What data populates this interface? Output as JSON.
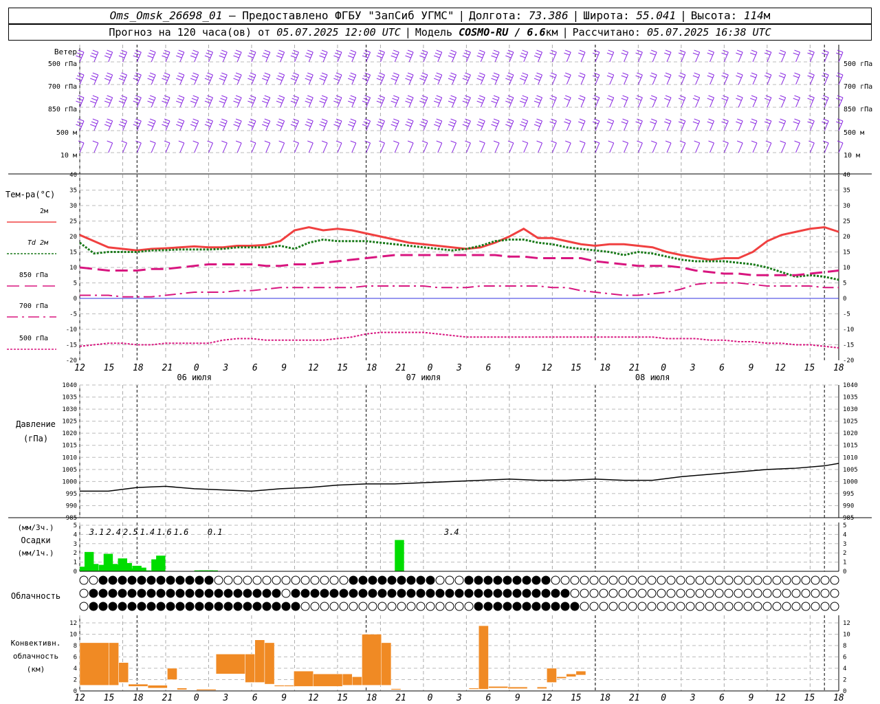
{
  "header": {
    "station": "Oms_Omsk_26698_01",
    "dash": "–",
    "provider": "Предоставлено ФГБУ \"ЗапСиб УГМС\"",
    "lon_label": "Долгота:",
    "lon_value": "73.386",
    "lat_label": "Широта:",
    "lat_value": "55.041",
    "alt_label": "Высота:",
    "alt_value": "114",
    "alt_unit": "м",
    "forecast_label": "Прогноз на 120 часа(ов) от",
    "forecast_start": "05.07.2025 12:00 UTC",
    "model_label": "Модель",
    "model_name": "COSMO-RU / 6.6",
    "model_unit": "км",
    "calc_label": "Рассчитано:",
    "calc_time": "05.07.2025 16:38 UTC"
  },
  "colors": {
    "wind": "#8b2be2",
    "t2m": "#f04040",
    "td": "#1a7a1a",
    "t850": "#d8157f",
    "zero": "#3030e0",
    "precip": "#00dd00",
    "conv": "#f08a24",
    "grid": "#bbbbbb"
  },
  "time_axis": {
    "hours": [
      "12",
      "15",
      "18",
      "21",
      "0",
      "3",
      "6",
      "9",
      "12",
      "15",
      "18",
      "21",
      "0",
      "3",
      "6",
      "9",
      "12",
      "15",
      "18",
      "21",
      "0",
      "3",
      "6",
      "9",
      "12",
      "15",
      "18"
    ],
    "dates": [
      "06 июля",
      "07 июля",
      "08 июля"
    ]
  },
  "panels": {
    "wind": {
      "title": "Ветер",
      "levels": [
        "500 гПа",
        "700 гПа",
        "850 гПа",
        "500 м",
        "10  м"
      ],
      "right_levels": [
        "500 гПа",
        "700 гПа",
        "850 гПа",
        "500 м",
        "10  м"
      ]
    },
    "temp": {
      "title": "Тем-ра(°С)",
      "legend": [
        "2м",
        "Td  2м",
        "850 гПа",
        "700 гПа",
        "500 гПа"
      ],
      "ticks": [
        "40",
        "35",
        "30",
        "25",
        "20",
        "15",
        "10",
        "5",
        "0",
        "-5",
        "-10",
        "-15",
        "-20"
      ]
    },
    "pressure": {
      "title": "Давление",
      "unit": "(гПа)",
      "ticks": [
        "1040",
        "1035",
        "1030",
        "1025",
        "1020",
        "1015",
        "1010",
        "1005",
        "1000",
        "995",
        "990",
        "985"
      ]
    },
    "precip": {
      "unit_top": "(мм/3ч.)",
      "title": "Осадки",
      "unit_bottom": "(мм/1ч.)",
      "ticks": [
        "5",
        "4",
        "3",
        "2",
        "1",
        "0"
      ],
      "totals": [
        {
          "x": 3,
          "text": "3.1"
        },
        {
          "x": 6,
          "text": "2.4"
        },
        {
          "x": 9,
          "text": "2.5"
        },
        {
          "x": 12,
          "text": "1.4"
        },
        {
          "x": 15,
          "text": "1.6"
        },
        {
          "x": 18,
          "text": "1.6"
        },
        {
          "x": 24,
          "text": "0.1"
        },
        {
          "x": 66,
          "text": "3.4"
        }
      ]
    },
    "cloud": {
      "title": "Облачность"
    },
    "conv": {
      "title_1": "Конвективн.",
      "title_2": "облачность",
      "unit": "(км)",
      "ticks": [
        "12",
        "10",
        "8",
        "6",
        "4",
        "2",
        "0"
      ]
    }
  },
  "chart_data": [
    {
      "type": "line",
      "title": "Тем-ра(°С)",
      "x_unit": "hours since 05.07.2025 12:00 UTC",
      "x": [
        0,
        3,
        6,
        9,
        12,
        15,
        18,
        21,
        24,
        27,
        30,
        33,
        36,
        39,
        42,
        45,
        48,
        51,
        54,
        57,
        60,
        63,
        66,
        69,
        72,
        75,
        78,
        81,
        84,
        87,
        90,
        93,
        96,
        99,
        102,
        105,
        108,
        111,
        114,
        117,
        120,
        123,
        126,
        129,
        132,
        135,
        138,
        141,
        144,
        147,
        150,
        153,
        156,
        159
      ],
      "ylim": [
        -20,
        40
      ],
      "series": [
        {
          "name": "2м",
          "style": "solid",
          "values": [
            20.5,
            18.5,
            16.5,
            16,
            15.5,
            16,
            16.2,
            16.5,
            16.8,
            16.5,
            16.5,
            17,
            17,
            17.3,
            18.5,
            22,
            23,
            22,
            22.5,
            22,
            21,
            20,
            19,
            18,
            17.5,
            17,
            16.5,
            16,
            16.5,
            18,
            20,
            22.5,
            19.5,
            19.5,
            18.5,
            17.5,
            17,
            17.5,
            17.5,
            17,
            16.5,
            15,
            14,
            13.2,
            12.5,
            13,
            13,
            15,
            18.5,
            20.5,
            21.5,
            22.5,
            23,
            21.5
          ]
        },
        {
          "name": "Td  2м",
          "style": "dotted",
          "values": [
            18,
            14.5,
            15,
            15,
            15,
            15.5,
            15.6,
            15.8,
            15.8,
            15.8,
            16,
            16.5,
            16.5,
            16.5,
            17,
            16,
            18,
            19,
            18.5,
            18.5,
            18.5,
            18,
            17.5,
            17,
            16.5,
            16,
            15.5,
            16,
            17,
            18.5,
            19,
            19,
            18,
            17.5,
            16.5,
            16,
            15.5,
            15,
            14,
            15,
            14.5,
            13.5,
            12.5,
            12,
            12,
            12,
            11.5,
            11,
            10,
            8.5,
            7,
            7.5,
            7,
            6
          ]
        },
        {
          "name": "850 гПа",
          "style": "dashed",
          "values": [
            10,
            9.5,
            9,
            9,
            9,
            9.5,
            9.5,
            10,
            10.5,
            11,
            11,
            11,
            11,
            10.5,
            10.5,
            11,
            11,
            11.5,
            12,
            12.5,
            13,
            13.5,
            14,
            14,
            14,
            14,
            14,
            14,
            14,
            14,
            13.5,
            13.5,
            13,
            13,
            13,
            13,
            12,
            11.5,
            11,
            10.5,
            10.5,
            10.5,
            10,
            9,
            8.5,
            8,
            8,
            7.5,
            7.5,
            7.5,
            7.5,
            8,
            8.5,
            9
          ]
        },
        {
          "name": "700 гПа",
          "style": "dashdot",
          "values": [
            1,
            1,
            1,
            0.5,
            0.5,
            0.5,
            1,
            1.5,
            2,
            2,
            2,
            2.5,
            2.5,
            3,
            3.5,
            3.5,
            3.5,
            3.5,
            3.5,
            3.5,
            4,
            4,
            4,
            4,
            4,
            3.5,
            3.5,
            3.5,
            4,
            4,
            4,
            4,
            4,
            3.5,
            3.5,
            2.5,
            2,
            1.5,
            1,
            1,
            1.5,
            2,
            3,
            4.5,
            5,
            5,
            5,
            4.5,
            4,
            4,
            4,
            4,
            3.5,
            3.5
          ]
        },
        {
          "name": "500 гПа",
          "style": "dotted",
          "values": [
            -15.5,
            -15,
            -14.5,
            -14.5,
            -15,
            -15,
            -14.5,
            -14.5,
            -14.5,
            -14.5,
            -13.5,
            -13,
            -13,
            -13.5,
            -13.5,
            -13.5,
            -13.5,
            -13.5,
            -13,
            -12.5,
            -11.5,
            -11,
            -11,
            -11,
            -11,
            -11.5,
            -12,
            -12.5,
            -12.5,
            -12.5,
            -12.5,
            -12.5,
            -12.5,
            -12.5,
            -12.5,
            -12.5,
            -12.5,
            -12.5,
            -12.5,
            -12.5,
            -12.5,
            -13,
            -13,
            -13,
            -13.5,
            -13.5,
            -14,
            -14,
            -14.5,
            -14.5,
            -15,
            -15,
            -15.5,
            -16
          ]
        }
      ]
    },
    {
      "type": "line",
      "title": "Давление",
      "x_unit": "hours since 05.07.2025 12:00 UTC",
      "ylim": [
        985,
        1040
      ],
      "x": [
        0,
        6,
        12,
        18,
        24,
        30,
        36,
        42,
        48,
        54,
        60,
        66,
        72,
        78,
        84,
        90,
        96,
        102,
        108,
        114,
        120,
        126,
        132,
        138,
        144,
        150,
        156,
        159
      ],
      "series": [
        {
          "name": "Давление",
          "values": [
            996,
            996,
            997.5,
            998,
            997,
            996.5,
            996,
            997,
            997.5,
            998.5,
            999,
            999,
            999.5,
            1000,
            1000.5,
            1001,
            1000.5,
            1000.5,
            1001,
            1000.5,
            1000.5,
            1002,
            1003,
            1004,
            1005,
            1005.5,
            1006.5,
            1007.5
          ]
        }
      ]
    },
    {
      "type": "bar",
      "title": "Осадки",
      "x_unit": "hours since 05.07.2025 12:00 UTC",
      "ylim": [
        0,
        5
      ],
      "x": [
        0,
        1,
        2,
        3,
        4,
        5,
        6,
        7,
        8,
        9,
        10,
        11,
        12,
        13,
        14,
        15,
        16,
        17,
        18,
        19,
        20,
        21,
        22,
        23,
        24,
        25,
        26,
        27,
        66
      ],
      "series": [
        {
          "name": "мм/1ч.",
          "values": [
            0.5,
            2.1,
            0.8,
            0.1,
            0.7,
            1.9,
            0.8,
            0.7,
            1.4,
            0.9,
            0.3,
            0.6,
            0.4,
            0.1,
            0,
            1.3,
            1.7,
            0,
            0,
            0,
            0,
            0,
            0,
            0,
            0.1,
            0.1,
            0.1,
            0.1,
            3.4
          ]
        }
      ]
    },
    {
      "type": "bar",
      "title": "Конвективн. облачность",
      "x_unit": "hours since 05.07.2025 12:00 UTC",
      "ylim": [
        0,
        12
      ],
      "bars": [
        {
          "x0": 0,
          "x1": 3,
          "base": 1,
          "top": 8.5
        },
        {
          "x0": 3,
          "x1": 4,
          "base": 1,
          "top": 8.5
        },
        {
          "x0": 4,
          "x1": 5,
          "base": 1.5,
          "top": 5
        },
        {
          "x0": 5,
          "x1": 7,
          "base": 0.8,
          "top": 1.2
        },
        {
          "x0": 7,
          "x1": 9,
          "base": 0.5,
          "top": 1
        },
        {
          "x0": 9,
          "x1": 10,
          "base": 2,
          "top": 4
        },
        {
          "x0": 10,
          "x1": 11,
          "base": 0.2,
          "top": 0.5
        },
        {
          "x0": 12,
          "x1": 14,
          "base": 0.1,
          "top": 0.3
        },
        {
          "x0": 14,
          "x1": 17,
          "base": 3,
          "top": 6.5
        },
        {
          "x0": 17,
          "x1": 18,
          "base": 1.5,
          "top": 6.5
        },
        {
          "x0": 18,
          "x1": 19,
          "base": 1.5,
          "top": 9
        },
        {
          "x0": 19,
          "x1": 20,
          "base": 1.2,
          "top": 8.5
        },
        {
          "x0": 20,
          "x1": 21,
          "base": 0.8,
          "top": 1
        },
        {
          "x0": 21,
          "x1": 22,
          "base": 0.8,
          "top": 1
        },
        {
          "x0": 22,
          "x1": 24,
          "base": 0.8,
          "top": 3.5
        },
        {
          "x0": 24,
          "x1": 27,
          "base": 0.8,
          "top": 3
        },
        {
          "x0": 27,
          "x1": 28,
          "base": 1,
          "top": 3
        },
        {
          "x0": 28,
          "x1": 29,
          "base": 1,
          "top": 2.5
        },
        {
          "x0": 29,
          "x1": 31,
          "base": 1,
          "top": 10
        },
        {
          "x0": 31,
          "x1": 32,
          "base": 1,
          "top": 8.5
        },
        {
          "x0": 32,
          "x1": 33,
          "base": 0.2,
          "top": 0.4
        },
        {
          "x0": 40,
          "x1": 41,
          "base": 0.3,
          "top": 0.5
        },
        {
          "x0": 41,
          "x1": 42,
          "base": 0.3,
          "top": 11.5
        },
        {
          "x0": 42,
          "x1": 44,
          "base": 0.5,
          "top": 0.8
        },
        {
          "x0": 44,
          "x1": 46,
          "base": 0.4,
          "top": 0.7
        },
        {
          "x0": 47,
          "x1": 48,
          "base": 0.4,
          "top": 0.7
        },
        {
          "x0": 48,
          "x1": 49,
          "base": 1.5,
          "top": 4
        },
        {
          "x0": 49,
          "x1": 50,
          "base": 2.2,
          "top": 2.5
        },
        {
          "x0": 50,
          "x1": 51,
          "base": 2.5,
          "top": 3
        },
        {
          "x0": 51,
          "x1": 52,
          "base": 2.8,
          "top": 3.5
        }
      ]
    }
  ]
}
